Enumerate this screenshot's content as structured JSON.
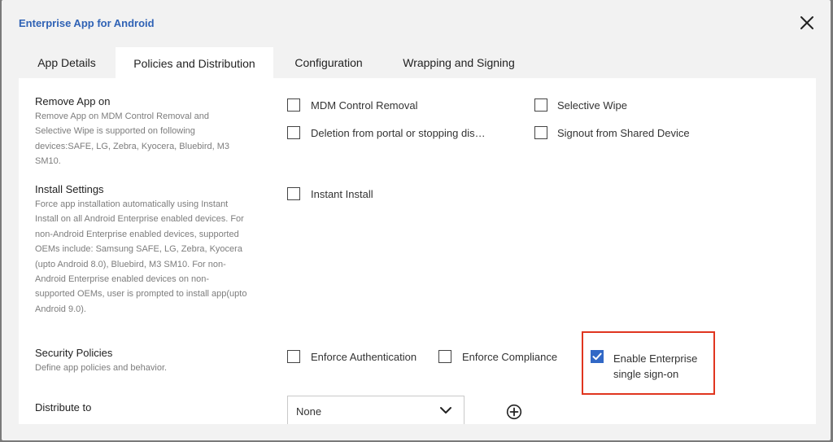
{
  "dialog": {
    "title": "Enterprise App for Android"
  },
  "tabs": [
    {
      "label": "App Details",
      "active": false
    },
    {
      "label": "Policies and Distribution",
      "active": true
    },
    {
      "label": "Configuration",
      "active": false
    },
    {
      "label": "Wrapping and Signing",
      "active": false
    }
  ],
  "sections": {
    "remove_app": {
      "title": "Remove App on",
      "desc": "Remove App on MDM Control Removal and Selective Wipe is supported on following devices:SAFE, LG, Zebra, Kyocera, Bluebird, M3 SM10.",
      "options": [
        {
          "label": "MDM Control Removal",
          "checked": false
        },
        {
          "label": "Selective Wipe",
          "checked": false
        },
        {
          "label": "Deletion from portal or stopping dis…",
          "checked": false
        },
        {
          "label": "Signout from Shared Device",
          "checked": false
        }
      ]
    },
    "install": {
      "title": "Install Settings",
      "desc": "Force app installation automatically using Instant Install on all Android Enterprise enabled devices. For non-Android Enterprise enabled devices, supported OEMs include: Samsung SAFE, LG, Zebra, Kyocera (upto Android 8.0), Bluebird, M3 SM10. For non-Android Enterprise enabled devices on non-supported OEMs, user is prompted to install app(upto Android 9.0).",
      "options": [
        {
          "label": "Instant Install",
          "checked": false
        }
      ]
    },
    "security": {
      "title": "Security Policies",
      "desc": "Define app policies and behavior.",
      "options": [
        {
          "label": "Enforce Authentication",
          "checked": false
        },
        {
          "label": "Enforce Compliance",
          "checked": false
        },
        {
          "label": "Enable Enterprise single sign-on",
          "checked": true
        }
      ]
    },
    "distribute": {
      "title": "Distribute to",
      "select_value": "None"
    }
  },
  "colors": {
    "accent": "#3168c6",
    "title": "#2f62b5",
    "highlight": "#e0351f"
  }
}
